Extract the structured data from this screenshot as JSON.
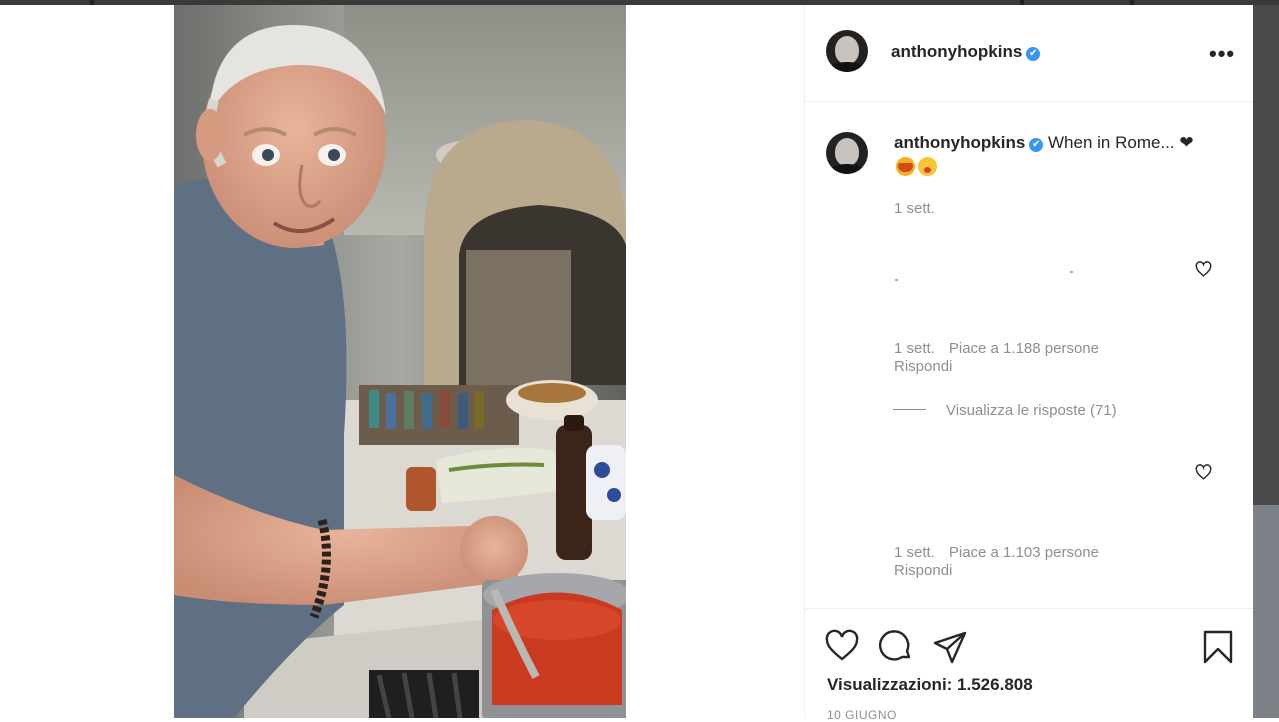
{
  "post": {
    "username": "anthonyhopkins",
    "caption": "When in Rome... ❤",
    "caption_emojis": [
      "spaghetti-emoji",
      "yum-emoji"
    ],
    "caption_time": "1 sett.",
    "comments": [
      {
        "time": "1 sett.",
        "likes": "Piace a 1.188 persone",
        "reply": "Rispondi",
        "view_replies": "Visualizza le risposte (71)"
      },
      {
        "time": "1 sett.",
        "likes": "Piace a 1.103 persone",
        "reply": "Rispondi"
      }
    ],
    "views": "Visualizzazioni: 1.526.808",
    "date": "10 GIUGNO",
    "more_icon": "•••",
    "verified_icon": "✔"
  },
  "icons": [
    "heart-icon",
    "comment-icon",
    "share-icon",
    "bookmark-icon",
    "more-options-icon",
    "verified-icon"
  ],
  "colors": {
    "verified": "#3897f0",
    "meta_text": "#8e8e8e",
    "border": "#efefef"
  }
}
